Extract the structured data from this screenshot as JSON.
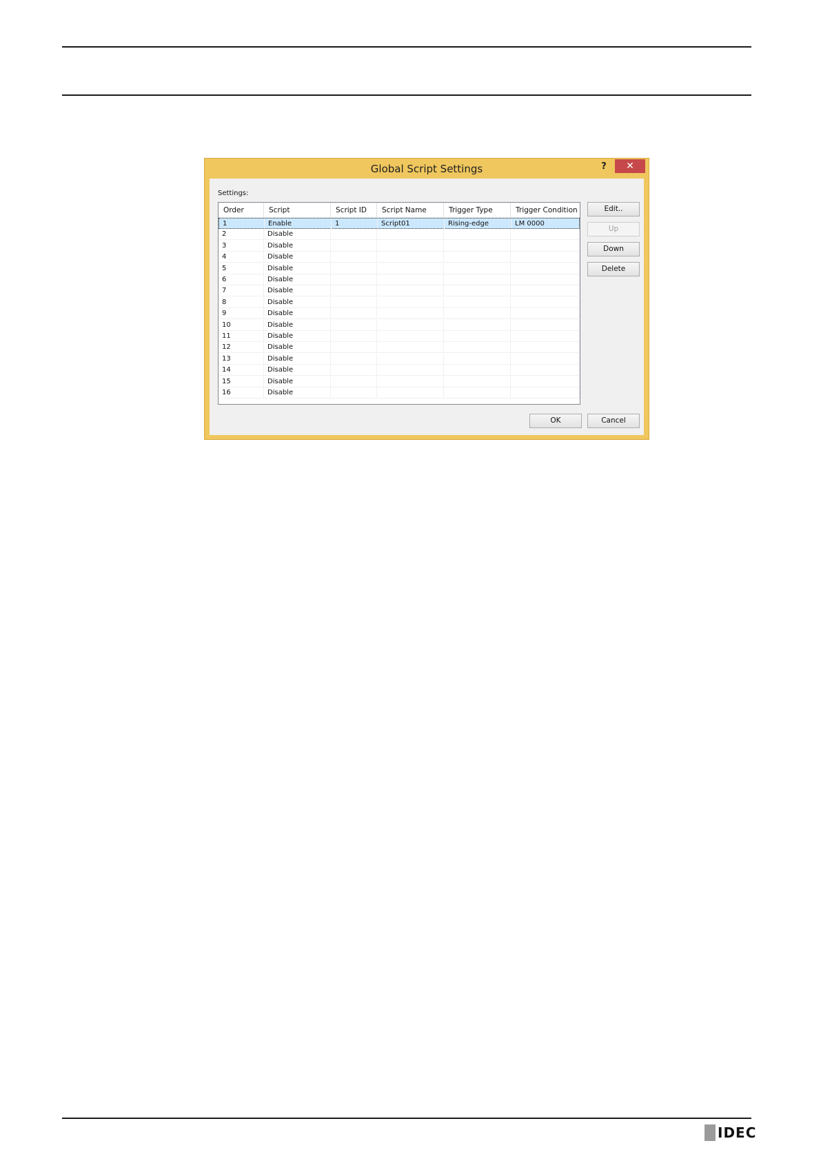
{
  "dialog": {
    "title": "Global Script Settings",
    "help_label": "?",
    "close_label": "✕",
    "settings_label": "Settings:",
    "columns": [
      "Order",
      "Script",
      "Script ID",
      "Script Name",
      "Trigger Type",
      "Trigger Condition"
    ],
    "rows": [
      [
        "1",
        "Enable",
        "1",
        "Script01",
        "Rising-edge",
        "LM 0000"
      ],
      [
        "2",
        "Disable",
        "",
        "",
        "",
        ""
      ],
      [
        "3",
        "Disable",
        "",
        "",
        "",
        ""
      ],
      [
        "4",
        "Disable",
        "",
        "",
        "",
        ""
      ],
      [
        "5",
        "Disable",
        "",
        "",
        "",
        ""
      ],
      [
        "6",
        "Disable",
        "",
        "",
        "",
        ""
      ],
      [
        "7",
        "Disable",
        "",
        "",
        "",
        ""
      ],
      [
        "8",
        "Disable",
        "",
        "",
        "",
        ""
      ],
      [
        "9",
        "Disable",
        "",
        "",
        "",
        ""
      ],
      [
        "10",
        "Disable",
        "",
        "",
        "",
        ""
      ],
      [
        "11",
        "Disable",
        "",
        "",
        "",
        ""
      ],
      [
        "12",
        "Disable",
        "",
        "",
        "",
        ""
      ],
      [
        "13",
        "Disable",
        "",
        "",
        "",
        ""
      ],
      [
        "14",
        "Disable",
        "",
        "",
        "",
        ""
      ],
      [
        "15",
        "Disable",
        "",
        "",
        "",
        ""
      ],
      [
        "16",
        "Disable",
        "",
        "",
        "",
        ""
      ]
    ],
    "selected_row": 1,
    "buttons": {
      "edit": "Edit..",
      "up": "Up",
      "down": "Down",
      "delete": "Delete",
      "ok": "OK",
      "cancel": "Cancel"
    },
    "colors": {
      "frame": "#f0c75e",
      "close": "#c7484a",
      "selection": "#cce8ff"
    }
  },
  "footer": {
    "logo_text": "IDEC"
  }
}
